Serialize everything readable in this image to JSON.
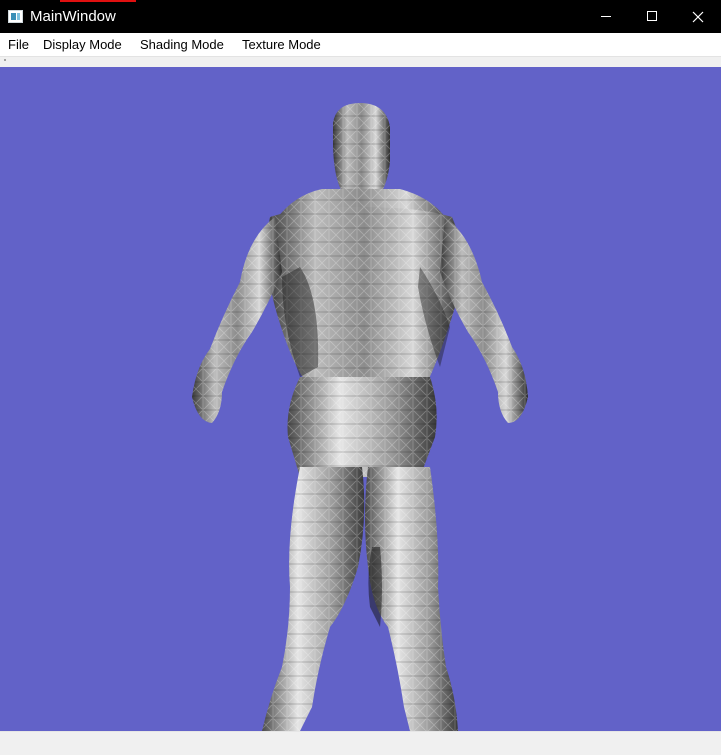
{
  "window": {
    "title": "MainWindow",
    "icon": "app-window-icon"
  },
  "window_controls": {
    "minimize_icon": "minimize-icon",
    "maximize_icon": "maximize-icon",
    "close_icon": "close-icon"
  },
  "menubar": {
    "items": [
      {
        "label": "File"
      },
      {
        "label": "Display Mode"
      },
      {
        "label": "Shading Mode"
      },
      {
        "label": "Texture Mode"
      }
    ]
  },
  "viewport": {
    "background_color": "#6262c8",
    "content": "3d-mesh-humanoid",
    "render_style": "flat-shaded grayscale triangle mesh"
  },
  "statusbar": {
    "text": ""
  }
}
